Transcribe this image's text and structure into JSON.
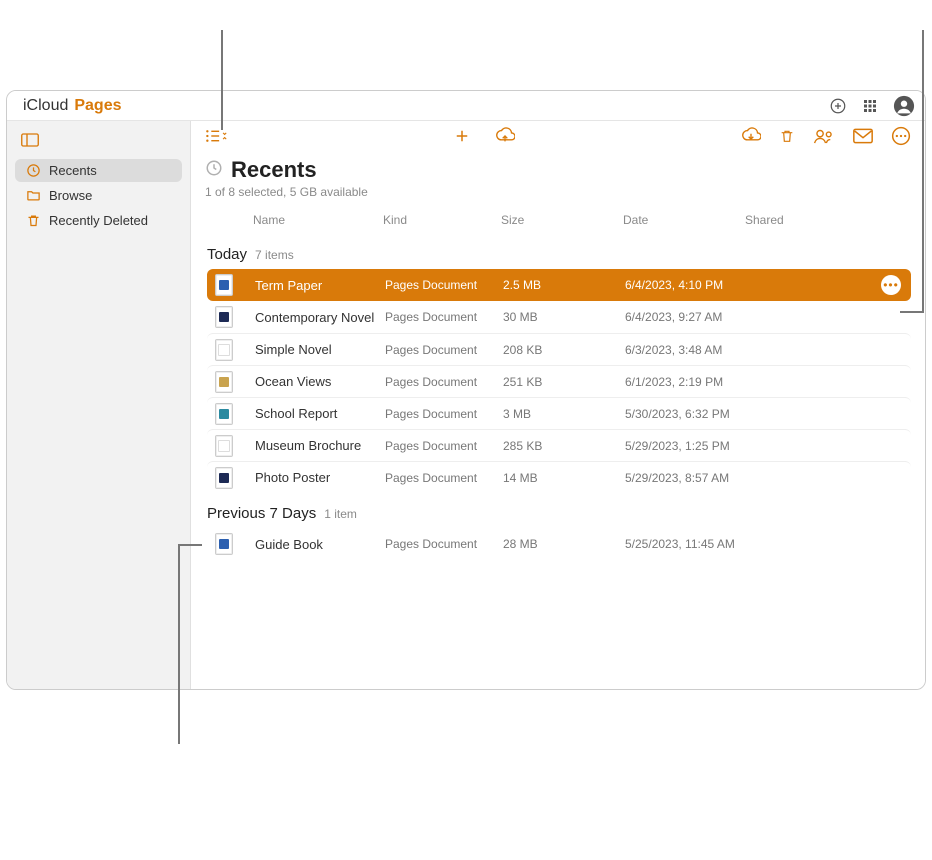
{
  "brand": {
    "icloud": "iCloud",
    "pages": "Pages"
  },
  "sidebar": {
    "items": [
      {
        "label": "Recents"
      },
      {
        "label": "Browse"
      },
      {
        "label": "Recently Deleted"
      }
    ]
  },
  "heading": {
    "title": "Recents",
    "subtitle": "1 of 8 selected, 5 GB available"
  },
  "columns": {
    "name": "Name",
    "kind": "Kind",
    "size": "Size",
    "date": "Date",
    "shared": "Shared"
  },
  "groups": [
    {
      "title": "Today",
      "count": "7 items",
      "rows": [
        {
          "name": "Term Paper",
          "kind": "Pages Document",
          "size": "2.5 MB",
          "date": "6/4/2023, 4:10 PM",
          "selected": true,
          "thumb": "blue"
        },
        {
          "name": "Contemporary Novel",
          "kind": "Pages Document",
          "size": "30 MB",
          "date": "6/4/2023, 9:27 AM",
          "selected": false,
          "thumb": "navy"
        },
        {
          "name": "Simple Novel",
          "kind": "Pages Document",
          "size": "208 KB",
          "date": "6/3/2023, 3:48 AM",
          "selected": false,
          "thumb": "white"
        },
        {
          "name": "Ocean Views",
          "kind": "Pages Document",
          "size": "251 KB",
          "date": "6/1/2023, 2:19 PM",
          "selected": false,
          "thumb": "gold"
        },
        {
          "name": "School Report",
          "kind": "Pages Document",
          "size": "3 MB",
          "date": "5/30/2023, 6:32 PM",
          "selected": false,
          "thumb": "teal"
        },
        {
          "name": "Museum Brochure",
          "kind": "Pages Document",
          "size": "285 KB",
          "date": "5/29/2023, 1:25 PM",
          "selected": false,
          "thumb": "white"
        },
        {
          "name": "Photo Poster",
          "kind": "Pages Document",
          "size": "14 MB",
          "date": "5/29/2023, 8:57 AM",
          "selected": false,
          "thumb": "navy"
        }
      ]
    },
    {
      "title": "Previous 7 Days",
      "count": "1 item",
      "rows": [
        {
          "name": "Guide Book",
          "kind": "Pages Document",
          "size": "28 MB",
          "date": "5/25/2023, 11:45 AM",
          "selected": false,
          "thumb": "blue"
        }
      ]
    }
  ],
  "colors": {
    "accent": "#d97a0a"
  }
}
